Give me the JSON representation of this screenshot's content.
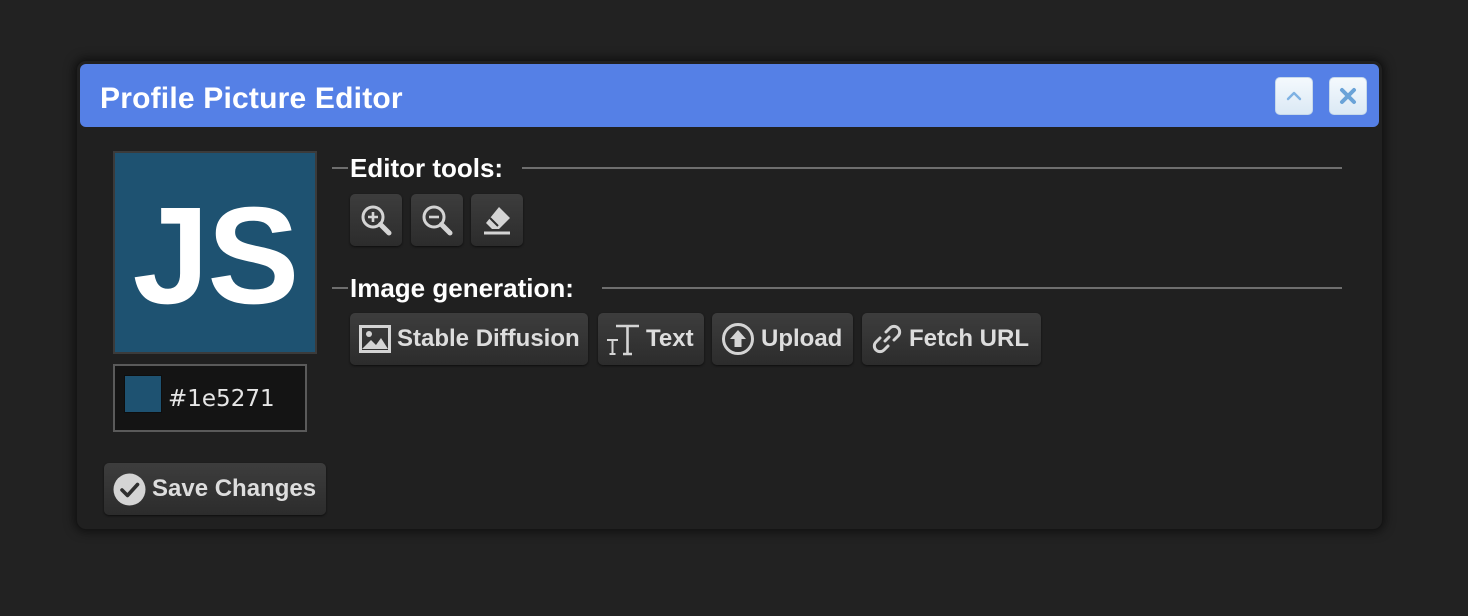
{
  "dialog": {
    "title": "Profile Picture Editor",
    "titlebar_color": "#5580e6",
    "collapse_icon": "chevron-up-icon",
    "close_icon": "close-icon"
  },
  "avatar": {
    "initials": "JS",
    "background_color": "#1e5271"
  },
  "color_picker": {
    "value": "#1e5271",
    "swatch_color": "#1e5271"
  },
  "editor_tools": {
    "label": "Editor tools:",
    "tools": [
      {
        "icon": "zoom-in-icon"
      },
      {
        "icon": "zoom-out-icon"
      },
      {
        "icon": "eraser-icon"
      }
    ]
  },
  "image_generation": {
    "label": "Image generation:",
    "buttons": [
      {
        "label": "Stable Diffusion",
        "icon": "image-icon"
      },
      {
        "label": "Text",
        "icon": "text-icon"
      },
      {
        "label": "Upload",
        "icon": "upload-icon"
      },
      {
        "label": "Fetch URL",
        "icon": "link-icon"
      }
    ]
  },
  "footer": {
    "save_label": "Save Changes",
    "save_icon": "check-circle-icon"
  }
}
